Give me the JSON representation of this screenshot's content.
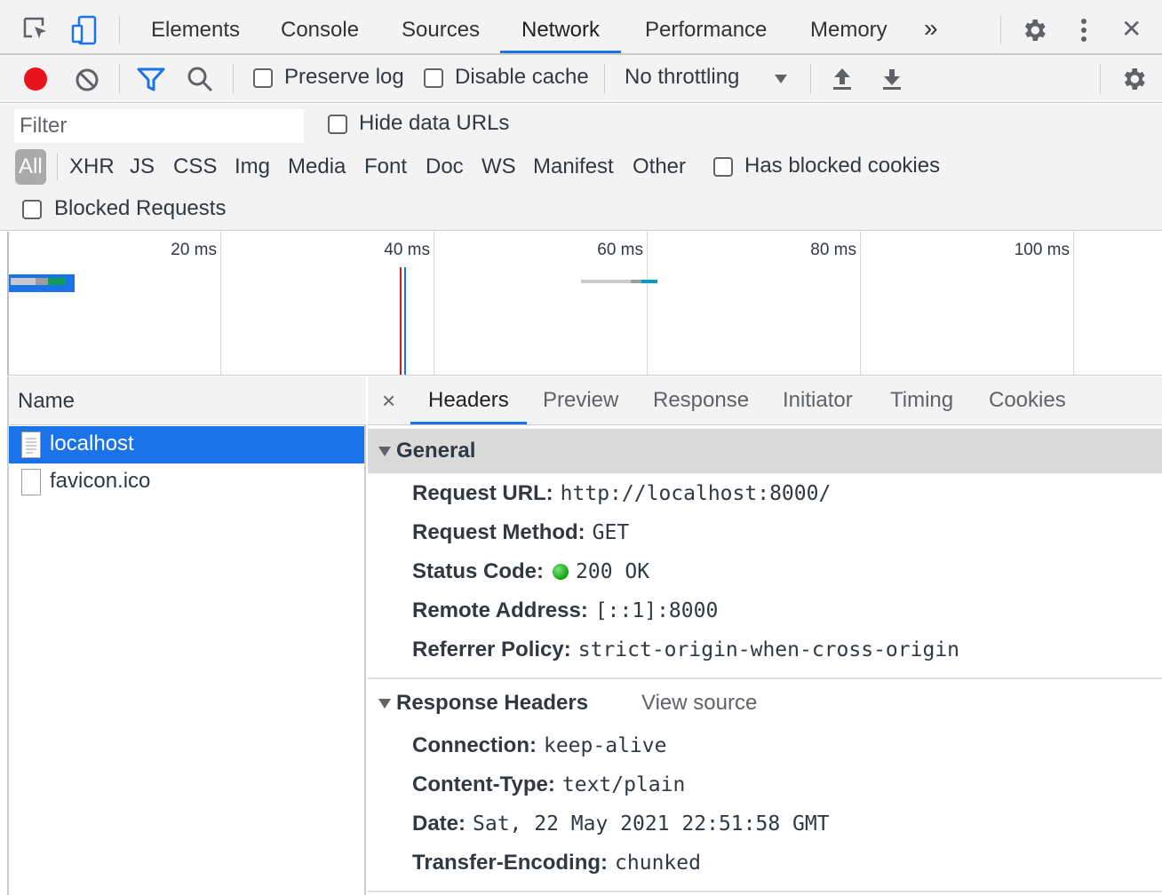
{
  "tabs": {
    "items": [
      "Elements",
      "Console",
      "Sources",
      "Network",
      "Performance",
      "Memory"
    ],
    "active": "Network",
    "more": "»",
    "close": "✕"
  },
  "toolbar": {
    "preserve_log": "Preserve log",
    "disable_cache": "Disable cache",
    "throttling": "No throttling"
  },
  "filter": {
    "placeholder": "Filter",
    "hide_data_urls": "Hide data URLs",
    "types": [
      "All",
      "XHR",
      "JS",
      "CSS",
      "Img",
      "Media",
      "Font",
      "Doc",
      "WS",
      "Manifest",
      "Other"
    ],
    "has_blocked_cookies": "Has blocked cookies",
    "blocked_requests": "Blocked Requests"
  },
  "overview": {
    "ticks": [
      "20 ms",
      "40 ms",
      "60 ms",
      "80 ms",
      "100 ms"
    ]
  },
  "requests": {
    "header": "Name",
    "rows": [
      "localhost",
      "favicon.ico"
    ],
    "selected": "localhost"
  },
  "details": {
    "close": "×",
    "tabs": [
      "Headers",
      "Preview",
      "Response",
      "Initiator",
      "Timing",
      "Cookies"
    ],
    "active_tab": "Headers",
    "general": {
      "title": "General",
      "request_url_key": "Request URL:",
      "request_url": "http://localhost:8000/",
      "request_method_key": "Request Method:",
      "request_method": "GET",
      "status_code_key": "Status Code:",
      "status_code": "200 OK",
      "remote_address_key": "Remote Address:",
      "remote_address": "[::1]:8000",
      "referrer_policy_key": "Referrer Policy:",
      "referrer_policy": "strict-origin-when-cross-origin"
    },
    "response_headers": {
      "title": "Response Headers",
      "view_source": "View source",
      "connection_key": "Connection:",
      "connection": "keep-alive",
      "content_type_key": "Content-Type:",
      "content_type": "text/plain",
      "date_key": "Date:",
      "date": "Sat, 22 May 2021 22:51:58 GMT",
      "transfer_encoding_key": "Transfer-Encoding:",
      "transfer_encoding": "chunked"
    }
  },
  "colors": {
    "accent": "#1a73e8",
    "record": "#e8131a",
    "status_ok": "#0ea30e"
  }
}
